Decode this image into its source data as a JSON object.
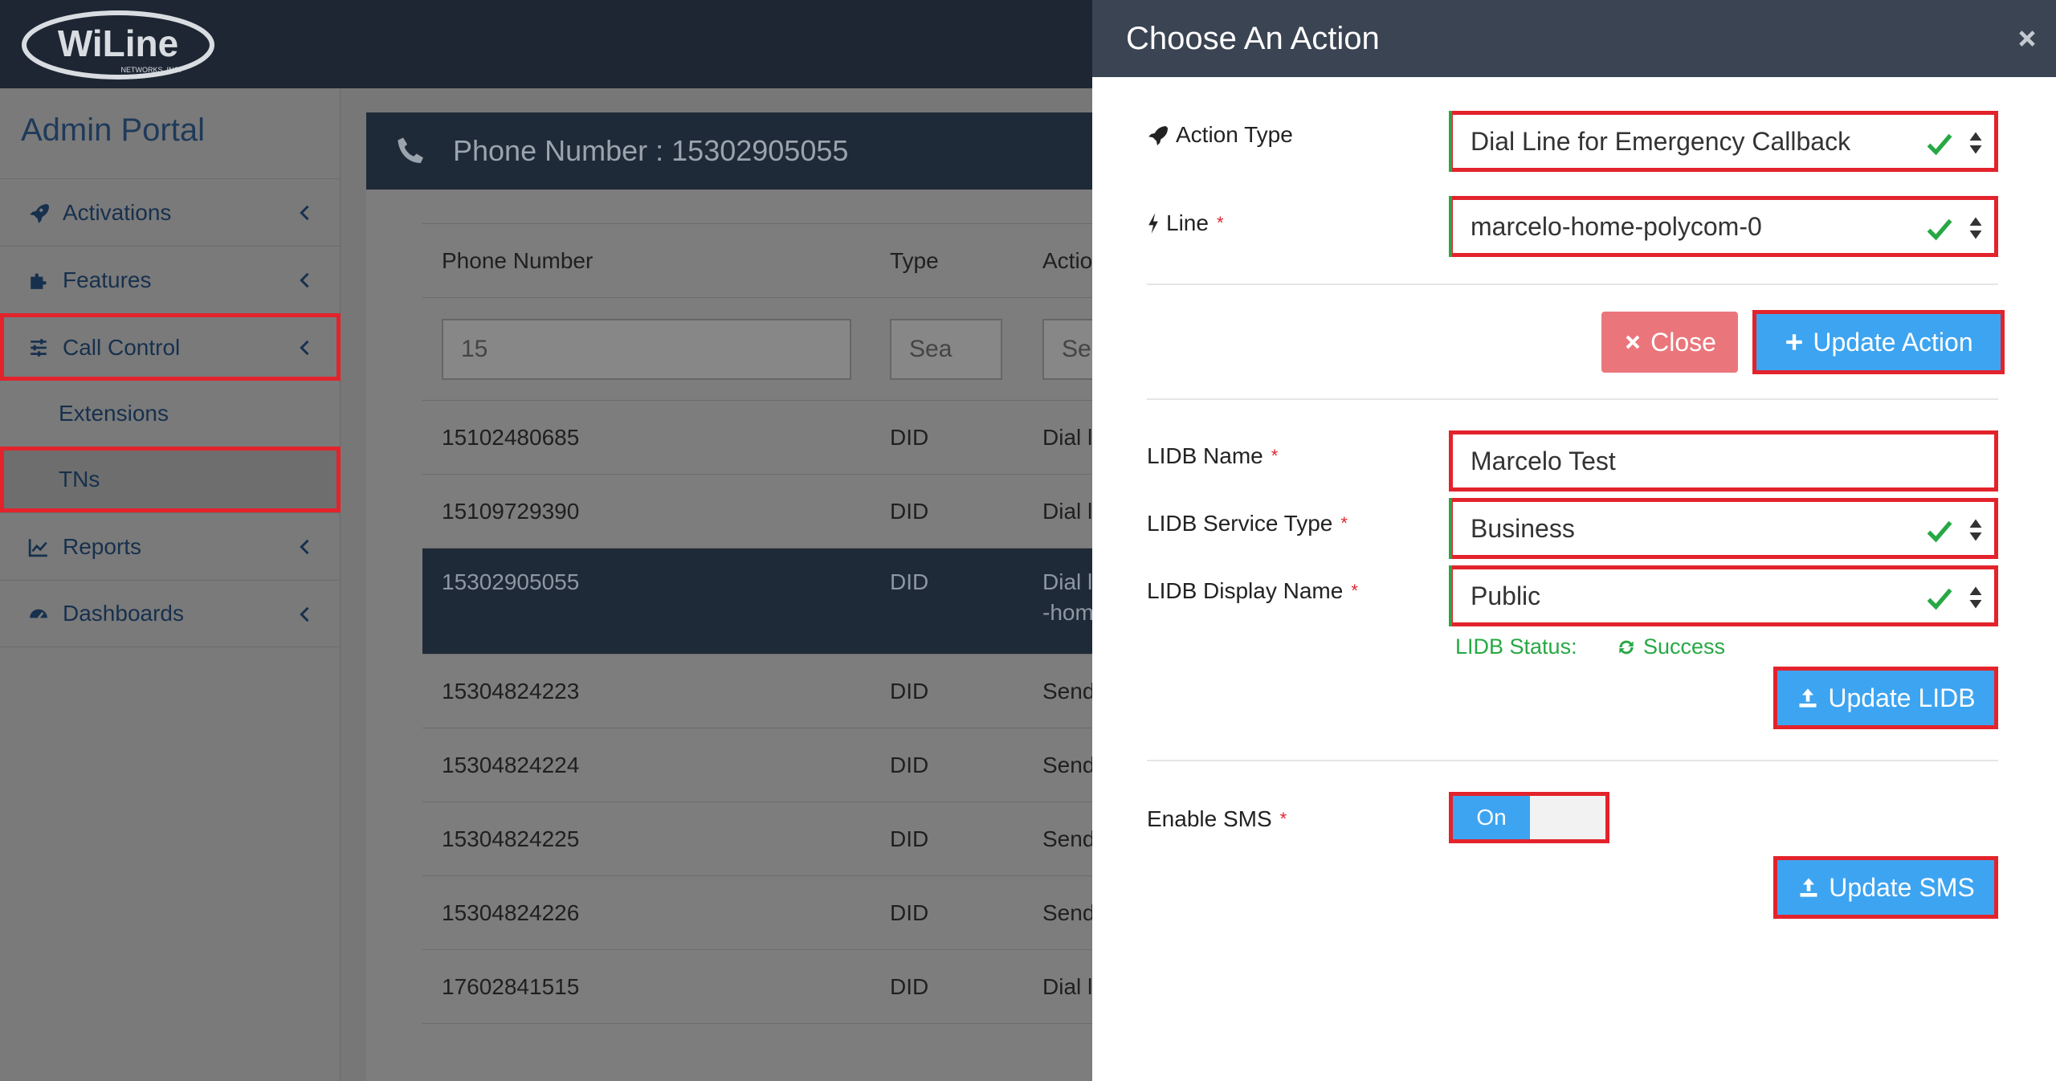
{
  "brand": {
    "logo_text": "WiLine",
    "logo_subtext": "NETWORKS, INC."
  },
  "sidebar": {
    "title": "Admin Portal",
    "items": [
      {
        "label": "Activations"
      },
      {
        "label": "Features"
      },
      {
        "label": "Call Control"
      },
      {
        "label": "Extensions"
      },
      {
        "label": "TNs"
      },
      {
        "label": "Reports"
      },
      {
        "label": "Dashboards"
      }
    ]
  },
  "main": {
    "header_title": "Phone Number : 15302905055",
    "columns": [
      "Phone Number",
      "Type",
      "Actio"
    ],
    "filters": [
      "15",
      "Sea",
      "Se"
    ],
    "rows": [
      {
        "number": "15102480685",
        "type": "DID",
        "action": "Dial l"
      },
      {
        "number": "15109729390",
        "type": "DID",
        "action": "Dial l"
      },
      {
        "number": "15302905055",
        "type": "DID",
        "action": "Dial l",
        "action2": "-hom"
      },
      {
        "number": "15304824223",
        "type": "DID",
        "action": "Send"
      },
      {
        "number": "15304824224",
        "type": "DID",
        "action": "Send"
      },
      {
        "number": "15304824225",
        "type": "DID",
        "action": "Send"
      },
      {
        "number": "15304824226",
        "type": "DID",
        "action": "Send"
      },
      {
        "number": "17602841515",
        "type": "DID",
        "action": "Dial l"
      }
    ]
  },
  "modal": {
    "title": "Choose An Action",
    "action_type_label": "Action Type",
    "action_type_value": "Dial Line for Emergency Callback",
    "line_label": "Line",
    "line_value": "marcelo-home-polycom-0",
    "close_label": "Close",
    "update_action_label": "Update Action",
    "lidb_name_label": "LIDB Name",
    "lidb_name_value": "Marcelo Test",
    "lidb_service_type_label": "LIDB Service Type",
    "lidb_service_type_value": "Business",
    "lidb_display_name_label": "LIDB Display Name",
    "lidb_display_name_value": "Public",
    "lidb_status_label": "LIDB Status:",
    "lidb_status_value": "Success",
    "update_lidb_label": "Update LIDB",
    "enable_sms_label": "Enable SMS",
    "sms_toggle_label": "On",
    "update_sms_label": "Update SMS",
    "required_mark": "*"
  },
  "colors": {
    "accent_blue": "#3da4f1",
    "highlight_red": "#e3232c",
    "success_green": "#27a844",
    "dark_header": "#1f2a38"
  }
}
